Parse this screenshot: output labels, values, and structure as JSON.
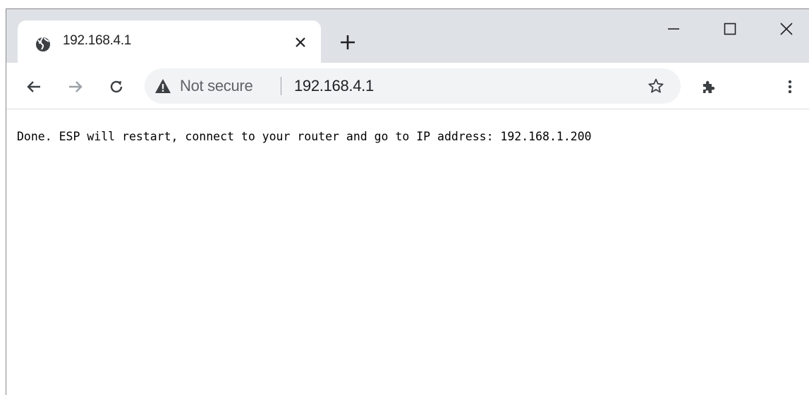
{
  "tab": {
    "title": "192.168.4.1",
    "favicon": "globe-icon"
  },
  "window_controls": [
    "minimize-icon",
    "maximize-icon",
    "close-icon"
  ],
  "toolbar": {
    "back_icon": "arrow-left-icon",
    "forward_icon": "arrow-right-icon",
    "reload_icon": "reload-icon",
    "security_icon": "warning-triangle-icon",
    "security_label": "Not secure",
    "url": "192.168.4.1",
    "bookmark_icon": "star-icon",
    "extensions_icon": "puzzle-icon",
    "menu_icon": "kebab-menu-icon"
  },
  "page": {
    "message": "Done. ESP will restart, connect to your router and go to IP address: 192.168.1.200"
  },
  "colors": {
    "tabstrip_bg": "#dee1e6",
    "omnibox_bg": "#f1f3f4",
    "icon": "#5f6368",
    "text": "#202124"
  }
}
